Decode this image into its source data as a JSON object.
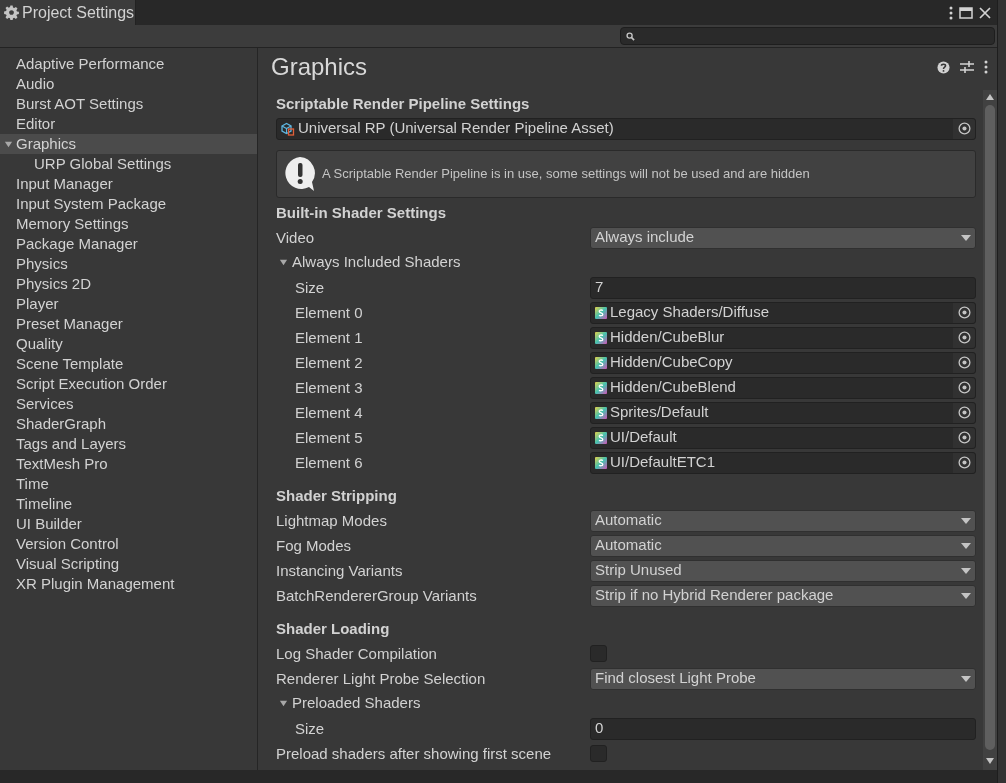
{
  "window": {
    "title": "Project Settings"
  },
  "sidebar": {
    "items": [
      {
        "label": "Adaptive Performance",
        "selected": false
      },
      {
        "label": "Audio",
        "selected": false
      },
      {
        "label": "Burst AOT Settings",
        "selected": false
      },
      {
        "label": "Editor",
        "selected": false
      },
      {
        "label": "Graphics",
        "selected": true,
        "expanded": true,
        "children": [
          {
            "label": "URP Global Settings",
            "selected": false
          }
        ]
      },
      {
        "label": "Input Manager",
        "selected": false
      },
      {
        "label": "Input System Package",
        "selected": false
      },
      {
        "label": "Memory Settings",
        "selected": false
      },
      {
        "label": "Package Manager",
        "selected": false
      },
      {
        "label": "Physics",
        "selected": false
      },
      {
        "label": "Physics 2D",
        "selected": false
      },
      {
        "label": "Player",
        "selected": false
      },
      {
        "label": "Preset Manager",
        "selected": false
      },
      {
        "label": "Quality",
        "selected": false
      },
      {
        "label": "Scene Template",
        "selected": false
      },
      {
        "label": "Script Execution Order",
        "selected": false
      },
      {
        "label": "Services",
        "selected": false
      },
      {
        "label": "ShaderGraph",
        "selected": false
      },
      {
        "label": "Tags and Layers",
        "selected": false
      },
      {
        "label": "TextMesh Pro",
        "selected": false
      },
      {
        "label": "Time",
        "selected": false
      },
      {
        "label": "Timeline",
        "selected": false
      },
      {
        "label": "UI Builder",
        "selected": false
      },
      {
        "label": "Version Control",
        "selected": false
      },
      {
        "label": "Visual Scripting",
        "selected": false
      },
      {
        "label": "XR Plugin Management",
        "selected": false
      }
    ]
  },
  "page": {
    "title": "Graphics"
  },
  "sections": [
    {
      "heading": "Scriptable Render Pipeline Settings",
      "rows": [
        {
          "kind": "asset",
          "value": "Universal RP (Universal Render Pipeline Asset)"
        },
        {
          "kind": "notice",
          "text": "A Scriptable Render Pipeline is in use, some settings will not be used and are hidden"
        }
      ]
    },
    {
      "heading": "Built-in Shader Settings",
      "rows": [
        {
          "kind": "dropdown",
          "label": "Video",
          "value": "Always include"
        },
        {
          "kind": "foldout",
          "label": "Always Included Shaders",
          "expanded": true,
          "children": [
            {
              "kind": "number",
              "label": "Size",
              "value": "7"
            },
            {
              "kind": "object",
              "label": "Element 0",
              "value": "Legacy Shaders/Diffuse"
            },
            {
              "kind": "object",
              "label": "Element 1",
              "value": "Hidden/CubeBlur"
            },
            {
              "kind": "object",
              "label": "Element 2",
              "value": "Hidden/CubeCopy"
            },
            {
              "kind": "object",
              "label": "Element 3",
              "value": "Hidden/CubeBlend"
            },
            {
              "kind": "object",
              "label": "Element 4",
              "value": "Sprites/Default"
            },
            {
              "kind": "object",
              "label": "Element 5",
              "value": "UI/Default"
            },
            {
              "kind": "object",
              "label": "Element 6",
              "value": "UI/DefaultETC1"
            }
          ]
        }
      ]
    },
    {
      "heading": "Shader Stripping",
      "rows": [
        {
          "kind": "dropdown",
          "label": "Lightmap Modes",
          "value": "Automatic"
        },
        {
          "kind": "dropdown",
          "label": "Fog Modes",
          "value": "Automatic"
        },
        {
          "kind": "dropdown",
          "label": "Instancing Variants",
          "value": "Strip Unused"
        },
        {
          "kind": "dropdown",
          "label": "BatchRendererGroup Variants",
          "value": "Strip if no Hybrid Renderer package"
        }
      ]
    },
    {
      "heading": "Shader Loading",
      "rows": [
        {
          "kind": "checkbox",
          "label": "Log Shader Compilation",
          "checked": false
        },
        {
          "kind": "dropdown",
          "label": "Renderer Light Probe Selection",
          "value": "Find closest Light Probe"
        },
        {
          "kind": "foldout",
          "label": "Preloaded Shaders",
          "expanded": true,
          "children": [
            {
              "kind": "number",
              "label": "Size",
              "value": "0"
            }
          ]
        },
        {
          "kind": "checkbox",
          "label": "Preload shaders after showing first scene",
          "checked": false
        }
      ]
    }
  ]
}
